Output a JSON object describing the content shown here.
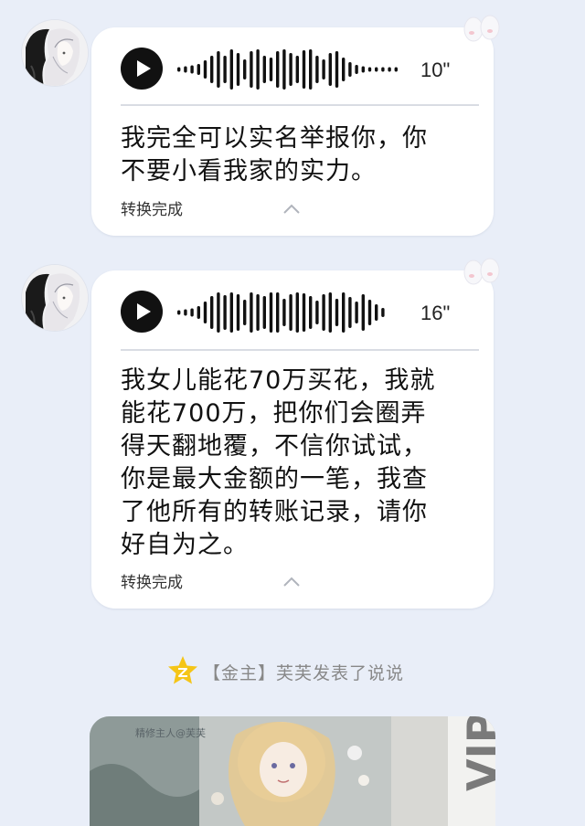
{
  "messages": [
    {
      "duration": "10\"",
      "transcript": "我完全可以实名举报你，你\n不要小看我家的实力。",
      "status": "转换完成"
    },
    {
      "duration": "16\"",
      "transcript": "我女儿能花70万买花，我就\n能花700万，把你们会圈弄\n得天翻地覆，不信你试试，\n你是最大金额的一笔，我查\n了他所有的转账记录，请你\n好自为之。",
      "status": "转换完成"
    }
  ],
  "notice": {
    "text": "【金主】芙芙发表了说说",
    "icon": "qzone-star-icon",
    "icon_color": "#f5c518"
  },
  "post": {
    "caption": "精修主人@芙芙"
  },
  "colors": {
    "background": "#e9eef8",
    "bubble": "#ffffff"
  }
}
